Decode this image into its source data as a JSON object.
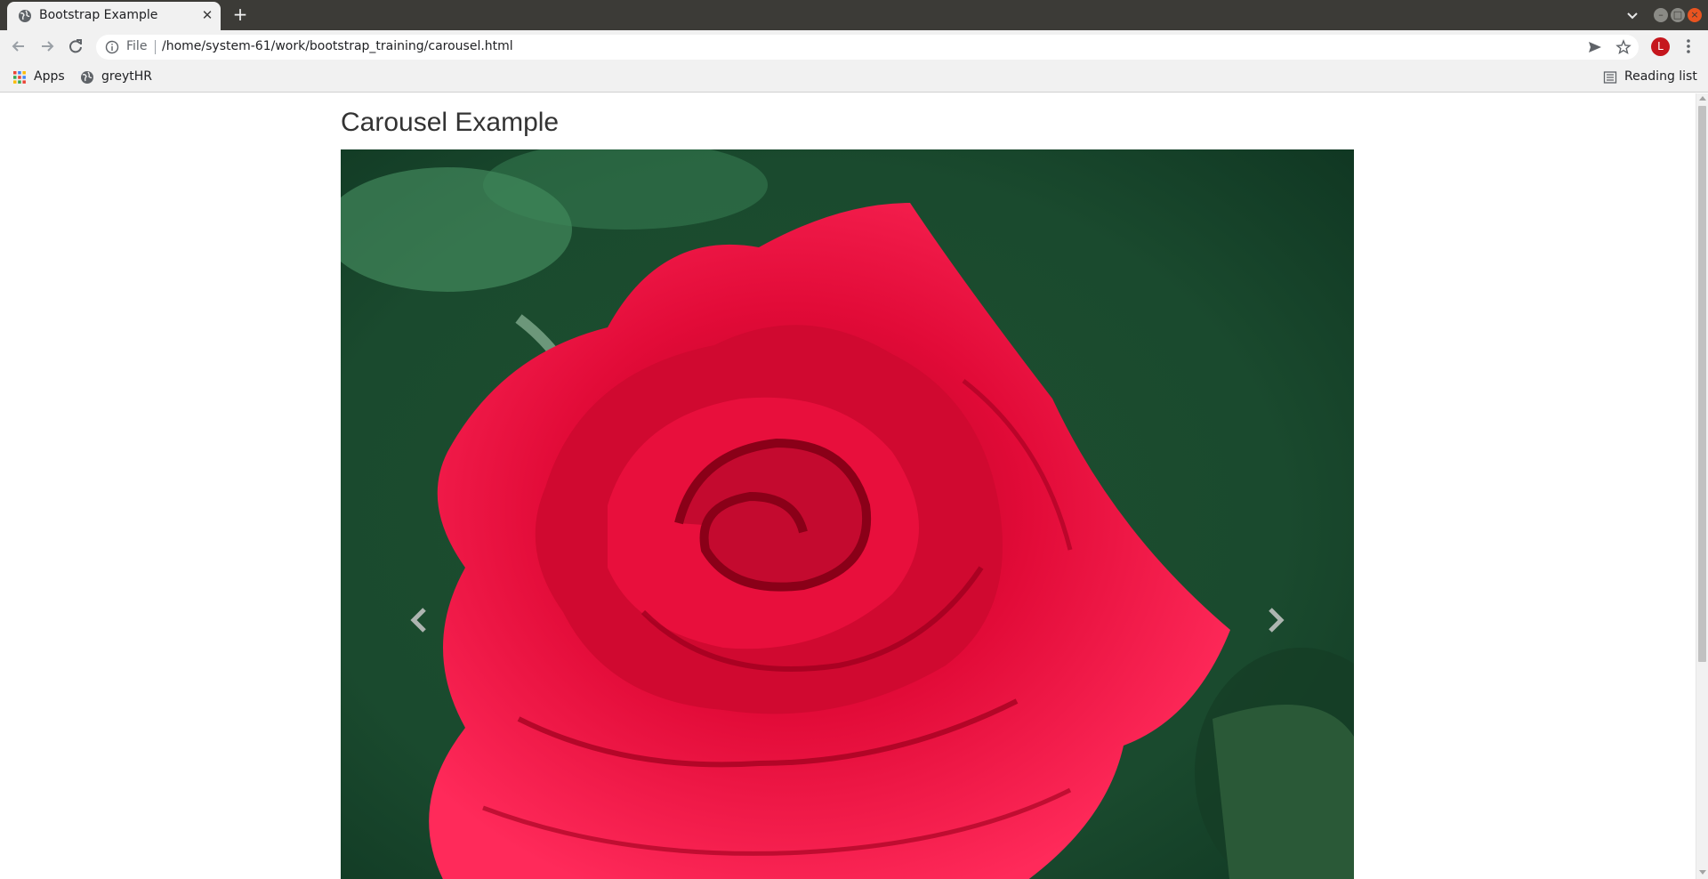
{
  "browser": {
    "tab": {
      "title": "Bootstrap Example",
      "icon": "globe-icon",
      "close_glyph": "✕"
    },
    "new_tab_glyph": "+",
    "omnibox": {
      "scheme_label": "File",
      "url": "/home/system-61/work/bootstrap_training/carousel.html"
    },
    "profile_initial": "L",
    "bookmarks": [
      {
        "label": "Apps",
        "icon": "apps-grid-icon"
      },
      {
        "label": "greytHR",
        "icon": "globe-icon"
      }
    ],
    "reading_list_label": "Reading list"
  },
  "page": {
    "heading": "Carousel Example",
    "carousel": {
      "active_slide_image": "red rose",
      "prev_icon": "chevron-left-icon",
      "next_icon": "chevron-right-icon"
    }
  },
  "colors": {
    "titlebar": "#3c3b37",
    "toolbar": "#f1f1f1",
    "avatar": "#c5161d",
    "rose": "#e0103a",
    "foliage": "#1f5a36"
  }
}
